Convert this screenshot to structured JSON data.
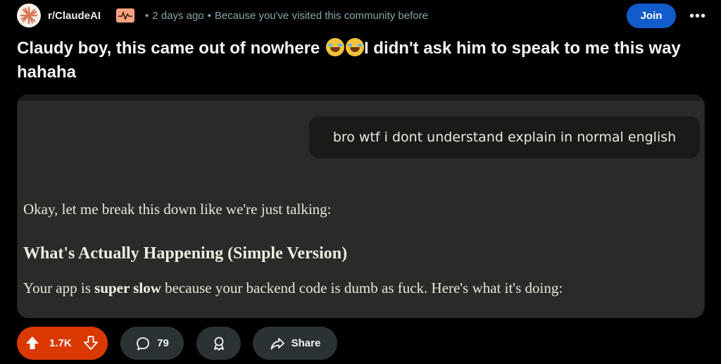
{
  "header": {
    "subreddit": "r/ClaudeAI",
    "time": "2 days ago",
    "reason": "Because you've visited this community before",
    "join_label": "Join",
    "more_label": "•••"
  },
  "post": {
    "title_part1": "Claudy boy, this came out of nowhere ",
    "title_part2": "I didn't ask him to speak to me this way hahaha",
    "emoji_icon": "face-with-tears-of-joy"
  },
  "media": {
    "user_message": "bro wtf i dont understand explain in normal english",
    "reply_intro": "Okay, let me break this down like we're just talking:",
    "reply_heading": "What's Actually Happening (Simple Version)",
    "reply_p_before": "Your app is ",
    "reply_p_bold": "super slow",
    "reply_p_after": " because your backend code is dumb as fuck. Here's what it's doing:"
  },
  "actions": {
    "vote_count": "1.7K",
    "comment_count": "79",
    "share_label": "Share"
  },
  "colors": {
    "vote_bg": "#d93900",
    "join_bg": "#115bca",
    "pill_bg": "#2a3236"
  }
}
